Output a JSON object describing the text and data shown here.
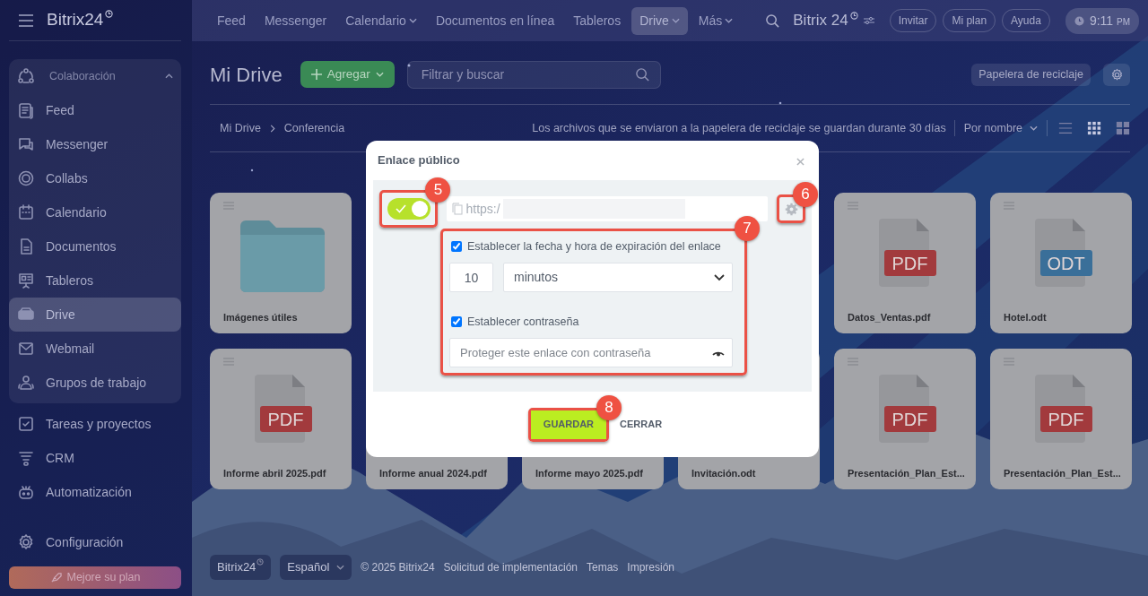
{
  "sidebar": {
    "logo": "Bitrix24",
    "group": {
      "title": "Colaboración",
      "expanded": true,
      "items": [
        {
          "label": "Feed",
          "kind": "feed",
          "selected": false
        },
        {
          "label": "Messenger",
          "kind": "chat",
          "selected": false
        },
        {
          "label": "Collabs",
          "kind": "ring",
          "selected": false
        },
        {
          "label": "Calendario",
          "kind": "calendar",
          "selected": false
        },
        {
          "label": "Documentos",
          "kind": "document",
          "selected": false
        },
        {
          "label": "Tableros",
          "kind": "board",
          "selected": false
        },
        {
          "label": "Drive",
          "kind": "drive",
          "selected": true
        },
        {
          "label": "Webmail",
          "kind": "mail",
          "selected": false
        },
        {
          "label": "Grupos de trabajo",
          "kind": "people",
          "selected": false
        }
      ]
    },
    "items": [
      {
        "label": "Tareas y proyectos",
        "kind": "tasks",
        "selected": false
      },
      {
        "label": "CRM",
        "kind": "funnel",
        "selected": false
      },
      {
        "label": "Automatización",
        "kind": "robot",
        "selected": false
      }
    ],
    "settings": "Configuración",
    "upgrade": "Mejore su plan"
  },
  "topbar": {
    "nav": [
      {
        "label": "Feed",
        "dropdown": false,
        "selected": false
      },
      {
        "label": "Messenger",
        "dropdown": false,
        "selected": false
      },
      {
        "label": "Calendario",
        "dropdown": true,
        "selected": false
      },
      {
        "label": "Documentos en línea",
        "dropdown": false,
        "selected": false
      },
      {
        "label": "Tableros",
        "dropdown": false,
        "selected": false
      },
      {
        "label": "Drive",
        "dropdown": true,
        "selected": true
      },
      {
        "label": "Más",
        "dropdown": true,
        "selected": false
      }
    ],
    "brand": "Bitrix 24",
    "buttons": [
      "Invitar",
      "Mi plan",
      "Ayuda"
    ],
    "time": "9:11",
    "meridiem": "PM"
  },
  "toolbar": {
    "title": "Mi Drive",
    "add_button": "Agregar",
    "search": {
      "placeholder": "Filtrar y buscar"
    },
    "trash_button": "Papelera de reciclaje"
  },
  "breadcrumb": [
    "Mi Drive",
    "Conferencia"
  ],
  "notice": "Los archivos que se enviaron a la papelera de reciclaje se guardan durante 30 días",
  "sort": "Por nombre",
  "views": [
    {
      "kind": "list",
      "selected": false
    },
    {
      "kind": "grid",
      "selected": true
    },
    {
      "kind": "tiles",
      "selected": false
    }
  ],
  "files": {
    "rows": [
      [
        {
          "name": "Imágenes útiles",
          "kind": "folder"
        },
        "",
        "",
        "",
        {
          "name": "Datos_Ventas.pdf",
          "kind": "pdf",
          "badge": "PDF"
        },
        {
          "name": "Hotel.odt",
          "kind": "odt",
          "badge": "ODT"
        }
      ],
      [
        {
          "name": "Informe abril 2025.pdf",
          "kind": "pdf",
          "badge": "PDF"
        },
        {
          "name": "Informe anual 2024.pdf"
        },
        {
          "name": "Informe mayo 2025.pdf"
        },
        {
          "name": "Invitación.odt"
        },
        {
          "name": "Presentación_Plan_Est...",
          "kind": "pdf",
          "badge": "PDF"
        },
        {
          "name": "Presentación_Plan_Est...",
          "kind": "pdf",
          "badge": "PDF"
        }
      ]
    ]
  },
  "footer": {
    "brand": "Bitrix24",
    "language": "Español",
    "copyright": "© 2025 Bitrix24",
    "links": [
      "Solicitud de implementación",
      "Temas",
      "Impresión"
    ]
  },
  "modal": {
    "title": "Enlace público",
    "link_on": true,
    "url": "https:/",
    "expiry": {
      "label": "Establecer la fecha y hora de expiración del enlace",
      "checked": true,
      "amount": "10",
      "unit": "minutos"
    },
    "password": {
      "label": "Establecer contraseña",
      "checked": true,
      "placeholder": "Proteger este enlace con contraseña"
    },
    "save_button": "GUARDAR",
    "close_button": "CERRAR",
    "callouts": [
      {
        "number": "5",
        "kind": "toggle"
      },
      {
        "number": "6",
        "kind": "settings"
      },
      {
        "number": "7",
        "kind": "options"
      },
      {
        "number": "8",
        "kind": "save"
      }
    ]
  }
}
